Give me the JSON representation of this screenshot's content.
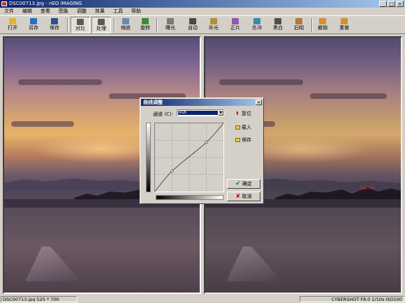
{
  "window": {
    "title": "DSC00713.jpg - nEO iMAGING",
    "colors": {
      "titlebar": "#0a246a",
      "face": "#d4d0c8"
    }
  },
  "menu": [
    "文件",
    "编辑",
    "查看",
    "图象",
    "调整",
    "效果",
    "工具",
    "帮助"
  ],
  "toolbar": [
    {
      "label": "打开",
      "icon": "open-folder-icon",
      "color": "#e2b23c"
    },
    {
      "label": "另存",
      "icon": "save-as-icon",
      "color": "#2d6fbf"
    },
    {
      "label": "保存",
      "icon": "save-disk-icon",
      "color": "#2d4f8f"
    },
    {
      "label": "对比",
      "icon": "compare-icon",
      "color": "#5a5a5a",
      "pressed": true
    },
    {
      "label": "处理",
      "icon": "process-icon",
      "color": "#5a5a5a",
      "pressed": true
    },
    {
      "label": "缩放",
      "icon": "zoom-icon",
      "color": "#6a8ab0"
    },
    {
      "label": "旋转",
      "icon": "rotate-icon",
      "color": "#3a8a3a"
    },
    {
      "label": "曝光",
      "icon": "exposure-icon",
      "color": "#7a7a7a"
    },
    {
      "label": "自动",
      "icon": "auto-icon",
      "color": "#4a4a4a"
    },
    {
      "label": "补光",
      "icon": "fill-light-icon",
      "color": "#b0903a"
    },
    {
      "label": "正片",
      "icon": "positive-film-icon",
      "color": "#8a5ab0"
    },
    {
      "label": "负冲",
      "icon": "cross-process-icon",
      "color": "#3a8ab0"
    },
    {
      "label": "黑白",
      "icon": "black-white-icon",
      "color": "#505050"
    },
    {
      "label": "旧相",
      "icon": "old-photo-icon",
      "color": "#b07a3a"
    },
    {
      "label": "撤销",
      "icon": "undo-icon",
      "color": "#d09030"
    },
    {
      "label": "重做",
      "icon": "redo-icon",
      "color": "#d09030"
    }
  ],
  "images": {
    "neon_sign": "SAN.FRE"
  },
  "status": {
    "left": "DSC00713.jpg  525 * 700",
    "right": "CYBERSHOT F8.0 1/10s ISO100"
  },
  "dialog": {
    "title": "曲线调整",
    "channel_label": "通道 (C):",
    "channel_value": "RGB",
    "reset_label": "复位",
    "load_label": "载入",
    "save_label": "保存",
    "ok_label": "确定",
    "cancel_label": "取消",
    "curve_points": [
      [
        0,
        0
      ],
      [
        0.25,
        0.3
      ],
      [
        0.75,
        0.72
      ],
      [
        1,
        1
      ]
    ]
  }
}
